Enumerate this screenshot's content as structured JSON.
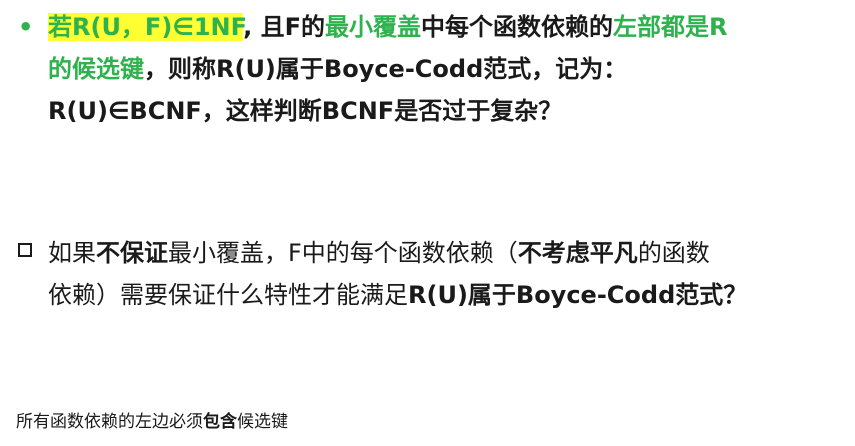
{
  "p1": {
    "bullet": "•",
    "l1a": "若R(U，F)∈1NF",
    "l1b": ", 且F的",
    "l1c": "最小覆盖",
    "l1d": "中每个函数依赖的",
    "l1e": "左部都是R",
    "l2a": "的候选键",
    "l2b": "，则称R(U)属于Boyce-Codd范式，记为：",
    "l3": "R(U)∈BCNF，这样判断BCNF是否过于复杂？"
  },
  "p2": {
    "l1a": "如果",
    "l1b": "不保证",
    "l1c": "最小覆盖，F中的每个函数依赖（",
    "l1d": "不考虑平凡",
    "l1e": "的函数",
    "l2a": "依赖）需要保证什么特性才能满足",
    "l2b": "R(U)属于Boyce-Codd范式？"
  },
  "note": {
    "a": "所有函数依赖的左边必须",
    "b": "包含",
    "c": "候选键"
  }
}
